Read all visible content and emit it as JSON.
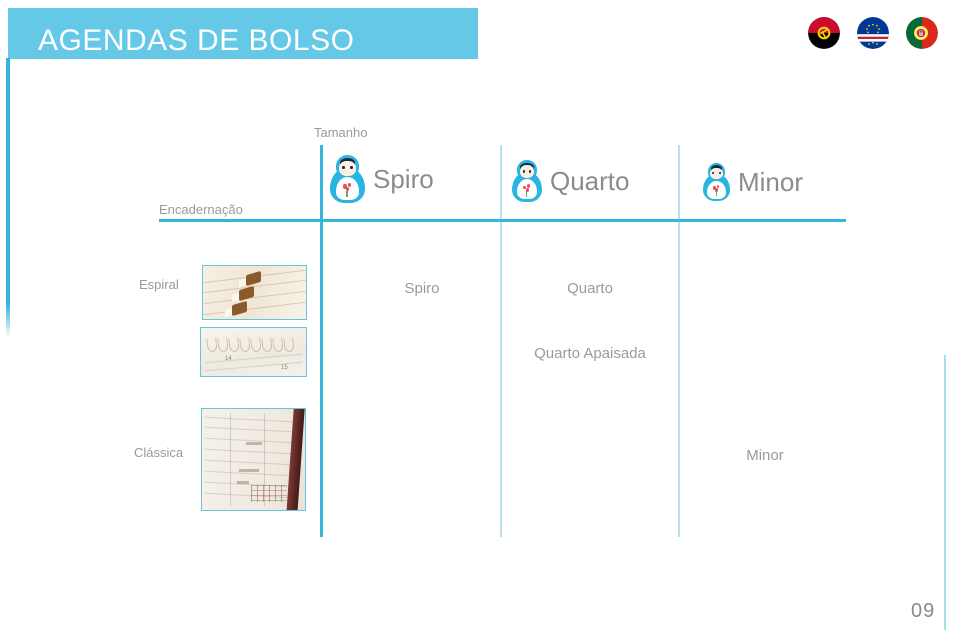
{
  "header": {
    "title": "AGENDAS DE BOLSO",
    "banner_color": "#64c8e6",
    "title_color": "#ffffff"
  },
  "flags": [
    {
      "name": "angola-flag",
      "label": "Angola"
    },
    {
      "name": "cape-verde-flag",
      "label": "Cabo Verde"
    },
    {
      "name": "portugal-flag",
      "label": "Portugal"
    }
  ],
  "matrix": {
    "column_axis_label": "Tamanho",
    "row_axis_label": "Encadernação",
    "accent_color": "#36b5dd",
    "divider_color": "#b9e0f0",
    "columns": [
      {
        "label": "Spiro",
        "icon": "matryoshka-doll-icon"
      },
      {
        "label": "Quarto",
        "icon": "matryoshka-doll-icon"
      },
      {
        "label": "Minor",
        "icon": "matryoshka-doll-icon"
      }
    ],
    "rows": [
      {
        "label": "Espiral"
      },
      {
        "label": "Clássica"
      }
    ],
    "cells": [
      {
        "text": "Spiro"
      },
      {
        "text": "Quarto"
      },
      {
        "text": "Quarto Apaisada"
      },
      {
        "text": "Minor"
      }
    ]
  },
  "footer": {
    "page_number": "09"
  }
}
